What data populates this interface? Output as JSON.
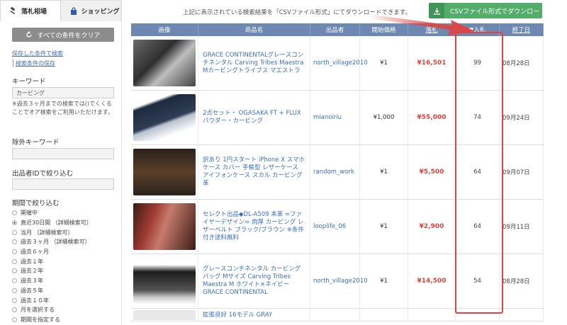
{
  "sidebar": {
    "tabs": [
      {
        "label": "落札相場",
        "active": true
      },
      {
        "label": "ショッピング",
        "active": false
      }
    ],
    "clear_button": "すべての条件をクリア",
    "saved_search_link": "保存した条件で検索",
    "save_conditions_link": "検索条件の保存",
    "keyword_label": "キーワード",
    "keyword_value": "カービング",
    "keyword_note": "※過去３ヶ月までの検索では()でくくることでオア検索をご利用いただけます。",
    "exclude_label": "除外キーワード",
    "seller_label": "出品者IDで絞り込む",
    "period_label": "期間で絞り込む",
    "period_options": [
      {
        "label": "開催中",
        "checked": false
      },
      {
        "label": "直近30日間 （詳細検索可）",
        "checked": true
      },
      {
        "label": "当月 （詳細検索可）",
        "checked": false
      },
      {
        "label": "過去３ヶ月 （詳細検索可）",
        "checked": false
      },
      {
        "label": "過去６ヶ月",
        "checked": false
      },
      {
        "label": "過去１年",
        "checked": false
      },
      {
        "label": "過去２年",
        "checked": false
      },
      {
        "label": "過去３年",
        "checked": false
      },
      {
        "label": "過去５年",
        "checked": false
      },
      {
        "label": "過去１０年",
        "checked": false
      },
      {
        "label": "月を選択する",
        "checked": false
      },
      {
        "label": "期間を指定する",
        "checked": false
      }
    ]
  },
  "main": {
    "info_text": "上記に表示されている検索結果を「CSVファイル形式」にてダウンロードできます。",
    "csv_button": "CSVファイル形式でダウンロー",
    "headers": {
      "image": "画像",
      "name": "商品名",
      "seller": "出品者",
      "start_price": "開始価格",
      "current_price": "落札",
      "bids": "▼入札",
      "end_date": "終了日"
    },
    "rows": [
      {
        "name": "GRACE CONTINENTALグレースコンチネンタル Carving Tribes Maestra Mカービングトライブス マエストラ",
        "seller": "north_village2010",
        "start_price": "¥1",
        "current_price": "¥16,501",
        "bids": "99",
        "end_date": "08月28日"
      },
      {
        "name": "2点セット・ OGASAKA FT + FLUX パウダー・カービング",
        "seller": "mianoiriu",
        "start_price": "¥1,000",
        "current_price": "¥55,000",
        "bids": "74",
        "end_date": "09月24日"
      },
      {
        "name": "訳あり 1円スタート iPhone X スマホケース カバー 手帳型 レザーケース アイフォンケース スカル カービング 革",
        "seller": "random_work",
        "start_price": "¥1",
        "current_price": "¥5,500",
        "bids": "64",
        "end_date": "09月07日"
      },
      {
        "name": "セレクト出品◆DL-A509 本革 =ファイヤーデザイン= 肉厚 カービング レザーベルト ブラック/ブラウン ※条件付き送料無料",
        "seller": "looplife_06",
        "start_price": "¥1",
        "current_price": "¥2,900",
        "bids": "64",
        "end_date": "09月11日"
      },
      {
        "name": "グレースコンチネンタル カービングバッグ Mサイズ Carving Tribes Maestra M ホワイト×ネイビー GRACE CONTINENTAL",
        "seller": "north_village2010",
        "start_price": "¥1",
        "current_price": "¥14,500",
        "bids": "54",
        "end_date": "08月28日"
      },
      {
        "name": "拡張良好 16モデル GRAY",
        "seller": "",
        "start_price": "",
        "current_price": "",
        "bids": "",
        "end_date": ""
      }
    ]
  },
  "colors": {
    "header_bg": "#6d89b2",
    "csv_green": "#52ad6a",
    "price_red": "#d9443a",
    "link_blue": "#3a6fbf",
    "highlight_red": "#e24242"
  }
}
